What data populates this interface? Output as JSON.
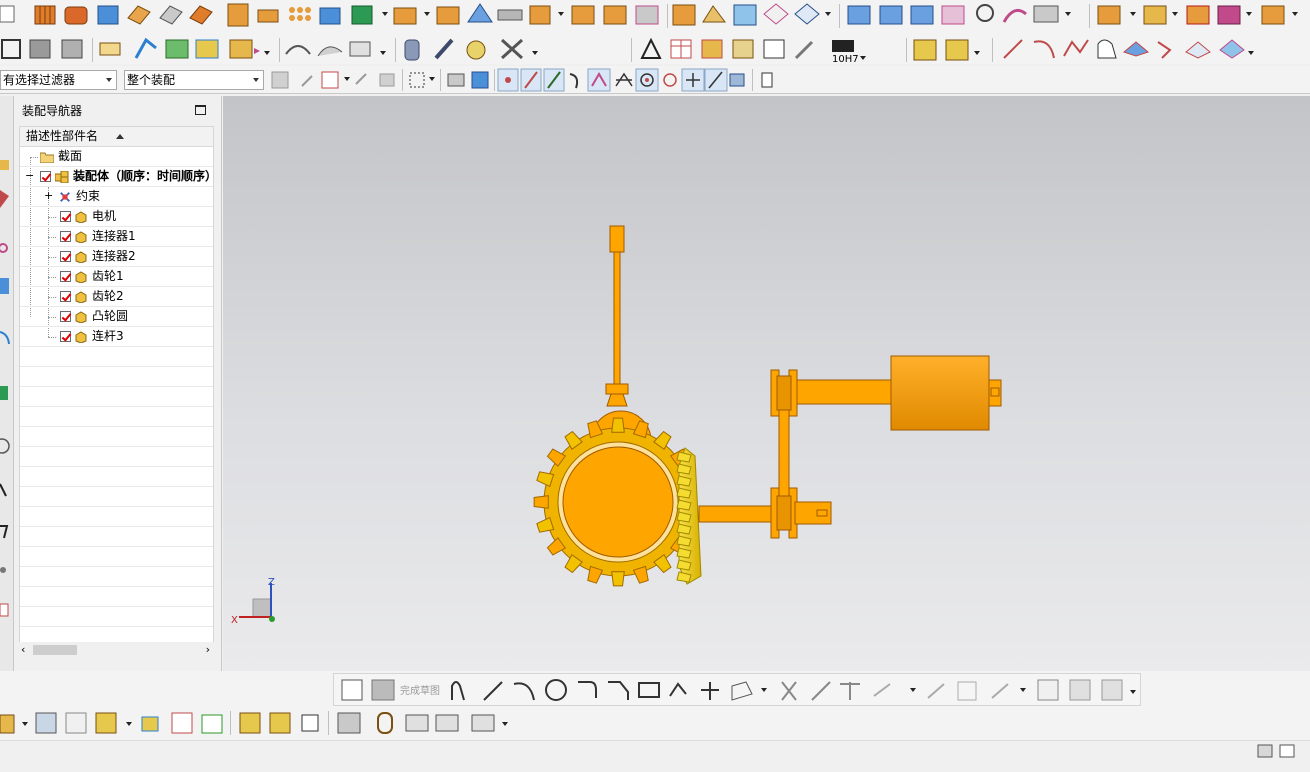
{
  "toolbar": {
    "selection_filter": "有选择过滤器",
    "assembly_scope": "整个装配",
    "tolerance_label": "10H7"
  },
  "navigator": {
    "title": "装配导航器",
    "column_header": "描述性部件名",
    "items": [
      {
        "label": "截面",
        "type": "folder"
      },
      {
        "label": "装配体（顺序：时间顺序）",
        "type": "assembly",
        "checked": true
      },
      {
        "label": "约束",
        "type": "constraints"
      },
      {
        "label": "电机",
        "type": "part",
        "checked": true
      },
      {
        "label": "连接器1",
        "type": "part",
        "checked": true
      },
      {
        "label": "连接器2",
        "type": "part",
        "checked": true
      },
      {
        "label": "齿轮1",
        "type": "part",
        "checked": true
      },
      {
        "label": "齿轮2",
        "type": "part",
        "checked": true
      },
      {
        "label": "凸轮圆",
        "type": "part",
        "checked": true
      },
      {
        "label": "连杆3",
        "type": "part",
        "checked": true
      }
    ]
  },
  "viewport": {
    "triad": {
      "z": "Z",
      "x": "X"
    },
    "model_color": "#ffa000",
    "gear_color": "#f5c800"
  },
  "sketch_toolbar": {
    "finish_sketch": "完成草图"
  }
}
